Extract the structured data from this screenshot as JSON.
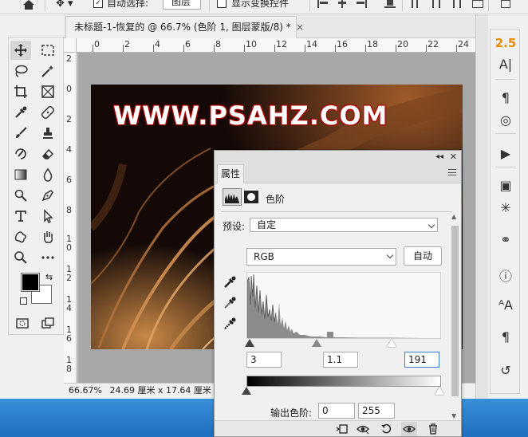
{
  "options_bar": {
    "auto_select_label": "自动选择:",
    "auto_select_value": "图层",
    "show_transform_label": "显示变换控件"
  },
  "document": {
    "tab_title": "未标题-1-恢复的 @ 66.7% (色阶 1, 图层蒙版/8) *",
    "close_glyph": "×",
    "watermark": "WWW.PSAHZ.COM",
    "ruler_h_ticks": [
      "0",
      "2",
      "4",
      "6",
      "8",
      "10",
      "12",
      "14",
      "16",
      "18",
      "20",
      "22",
      "24"
    ],
    "ruler_v_ticks": [
      "2",
      "0",
      "2",
      "4",
      "6",
      "8",
      "1\n0",
      "1\n2",
      "1\n4",
      "1\n6",
      "1\n8"
    ],
    "zoom": "66.67%",
    "size_info": "24.69 厘米 x 17.64 厘米 (7"
  },
  "right_panel": {
    "top_value": "2.5"
  },
  "properties": {
    "tab_label": "属性",
    "panel_title": "色阶",
    "preset_label": "预设:",
    "preset_value": "自定",
    "channel_value": "RGB",
    "auto_button": "自动",
    "input_black": "3",
    "input_gamma": "1.1",
    "input_white": "191",
    "output_label": "输出色阶:",
    "output_black": "0",
    "output_white": "255"
  },
  "colors": {
    "accent_orange": "#e88b00",
    "focus_blue": "#3c7ed8",
    "taskbar": "#2a7fd0"
  }
}
